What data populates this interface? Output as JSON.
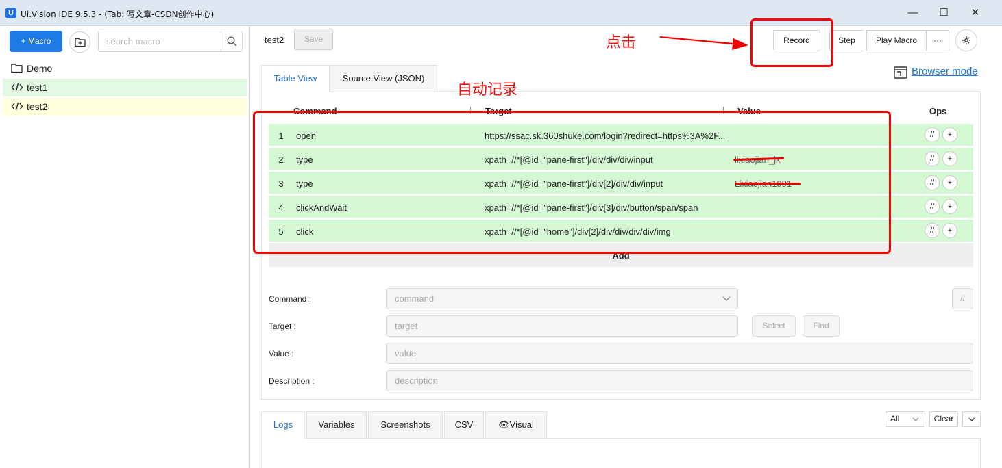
{
  "window": {
    "logo": "U",
    "title": "Ui.Vision IDE 9.5.3 - (Tab: 写文章-CSDN创作中心)",
    "minimize": "—",
    "maximize": "☐",
    "close": "✕"
  },
  "sidebar": {
    "new_macro_label": "+ Macro",
    "search_placeholder": "search macro",
    "items": [
      {
        "label": "Demo",
        "icon": "folder-icon"
      },
      {
        "label": "test1",
        "icon": "code-icon"
      },
      {
        "label": "test2",
        "icon": "code-icon"
      }
    ]
  },
  "toolbar": {
    "macro_name": "test2",
    "save_label": "Save",
    "record_label": "Record",
    "step_label": "Step",
    "play_label": "Play Macro",
    "more_label": "···"
  },
  "tabs": {
    "table_view": "Table View",
    "source_view": "Source View (JSON)"
  },
  "browser_mode_label": "Browser mode",
  "table": {
    "headers": {
      "command": "Command",
      "target": "Target",
      "value": "Value",
      "ops": "Ops"
    },
    "rows": [
      {
        "num": "1",
        "command": "open",
        "target": "https://ssac.sk.360shuke.com/login?redirect=https%3A%2F...",
        "value": ""
      },
      {
        "num": "2",
        "command": "type",
        "target": "xpath=//*[@id=\"pane-first\"]/div/div/div/input",
        "value": "lixiaojian_jk"
      },
      {
        "num": "3",
        "command": "type",
        "target": "xpath=//*[@id=\"pane-first\"]/div[2]/div/div/input",
        "value": "Lixiaojian1991"
      },
      {
        "num": "4",
        "command": "clickAndWait",
        "target": "xpath=//*[@id=\"pane-first\"]/div[3]/div/button/span/span",
        "value": ""
      },
      {
        "num": "5",
        "command": "click",
        "target": "xpath=//*[@id=\"home\"]/div[2]/div/div/div/div/img",
        "value": ""
      }
    ],
    "op_comment": "//",
    "op_add": "+",
    "add_label": "Add"
  },
  "form": {
    "command_label": "Command :",
    "command_placeholder": "command",
    "target_label": "Target :",
    "target_placeholder": "target",
    "value_label": "Value :",
    "value_placeholder": "value",
    "description_label": "Description :",
    "description_placeholder": "description",
    "select_label": "Select",
    "find_label": "Find",
    "comment_label": "//"
  },
  "bottom_tabs": [
    "Logs",
    "Variables",
    "Screenshots",
    "CSV",
    "Visual"
  ],
  "log_filter": {
    "selected": "All",
    "clear_label": "Clear"
  },
  "annotations": {
    "click": "点击",
    "auto_record": "自动记录"
  },
  "colors": {
    "accent": "#1f7ae6",
    "row_green": "#d4f7d4",
    "annotation_red": "#ff0000"
  }
}
